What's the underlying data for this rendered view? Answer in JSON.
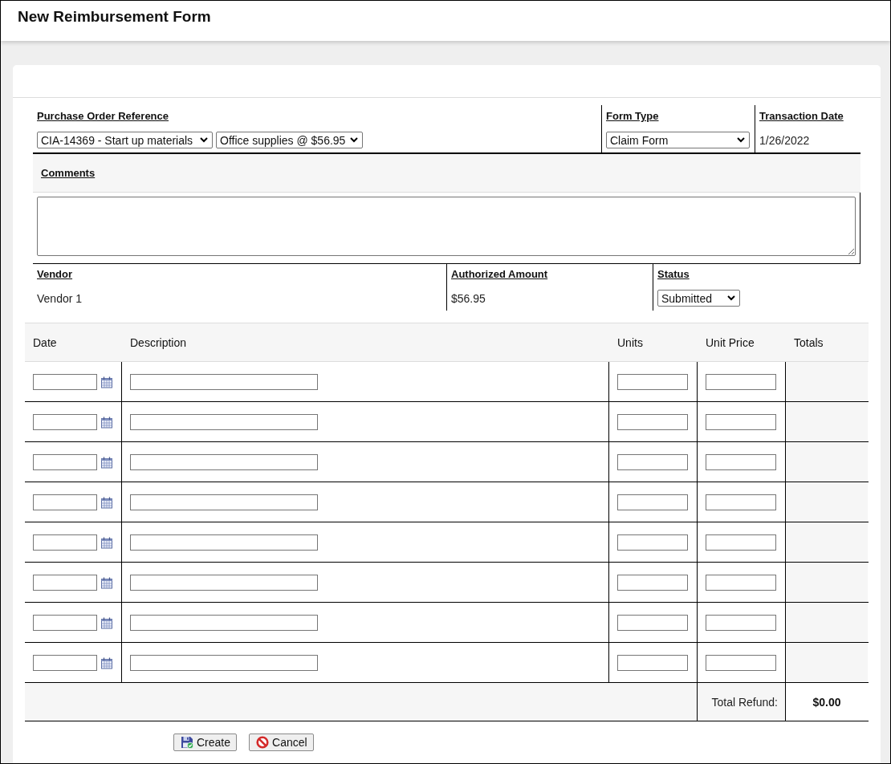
{
  "header": {
    "title": "New Reimbursement Form"
  },
  "form": {
    "purchase_order_reference": {
      "label": "Purchase Order Reference",
      "order_select": "CIA-14369 - Start up materials",
      "item_select": "Office supplies @ $56.95"
    },
    "form_type": {
      "label": "Form Type",
      "value": "Claim Form"
    },
    "transaction_date": {
      "label": "Transaction Date",
      "value": "1/26/2022"
    },
    "comments": {
      "label": "Comments"
    },
    "vendor": {
      "label": "Vendor",
      "value": "Vendor 1"
    },
    "authorized_amount": {
      "label": "Authorized Amount",
      "value": "$56.95"
    },
    "status": {
      "label": "Status",
      "value": "Submitted"
    }
  },
  "line_items": {
    "columns": [
      "Date",
      "Description",
      "Units",
      "Unit Price",
      "Totals"
    ],
    "rows": [
      {
        "kind": "entry"
      },
      {
        "kind": "entry"
      },
      {
        "kind": "entry"
      },
      {
        "kind": "entry"
      },
      {
        "kind": "entry"
      },
      {
        "kind": "entry"
      },
      {
        "kind": "entry"
      },
      {
        "kind": "entry"
      }
    ],
    "total_label": "Total Refund:",
    "total_value": "$0.00"
  },
  "buttons": [
    {
      "label": "Create",
      "kind": "create"
    },
    {
      "label": "Cancel",
      "kind": "cancel"
    }
  ]
}
